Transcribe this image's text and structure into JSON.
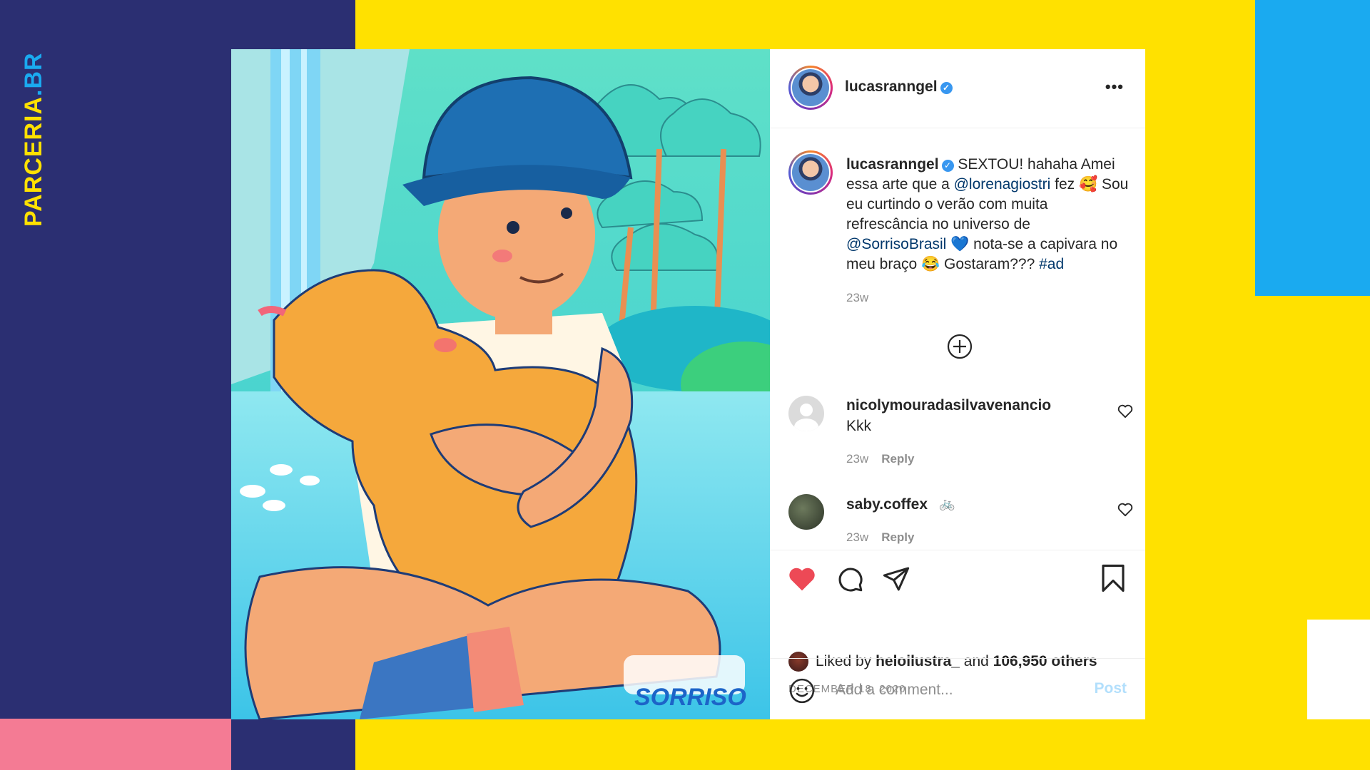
{
  "brand": {
    "part1": "PAR",
    "part2": "CERIA",
    "part3": ".BR"
  },
  "post": {
    "username": "lucasranngel",
    "verified_mark": "✓",
    "more_label": "•••",
    "caption": {
      "username": "lucasranngel",
      "t1": " SEXTOU! hahaha Amei essa arte que a ",
      "mention1": "@lorenagiostri",
      "t2": " fez 🥰 Sou eu curtindo o verão com muita refrescância no universo de ",
      "mention2": "@SorrisoBrasil",
      "t3": " 💙 nota-se a capivara no meu braço 😂 Gostaram??? ",
      "hashtag": "#ad",
      "time": "23w"
    },
    "comments": [
      {
        "username": "nicolymouradasilvavenancio",
        "text": "Kkk",
        "time": "23w",
        "reply": "Reply"
      },
      {
        "username": "saby.coffex",
        "text": "🚲",
        "time": "23w",
        "reply": "Reply"
      }
    ],
    "likes": {
      "prefix": "Liked by ",
      "user": "heloilustra_",
      "mid": " and ",
      "count": "106,950 others"
    },
    "date": "DECEMBER 18, 2020",
    "add_comment": {
      "placeholder": "Add a comment...",
      "post_label": "Post"
    },
    "image_logo": "SORRISO"
  },
  "colors": {
    "navy": "#2b2f72",
    "yellow": "#ffe100",
    "blue": "#1aaaf0",
    "pink": "#f47b94",
    "like_red": "#ed4956",
    "link": "#00376b"
  }
}
